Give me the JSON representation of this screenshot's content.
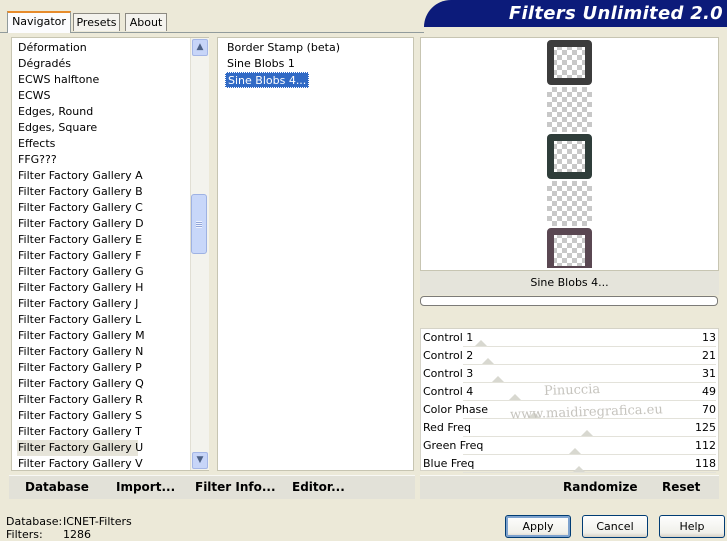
{
  "tabs": [
    {
      "label": "Navigator",
      "active": true
    },
    {
      "label": "Presets",
      "active": false
    },
    {
      "label": "About",
      "active": false
    }
  ],
  "banner": {
    "title": "Filters Unlimited 2.0"
  },
  "categories": [
    "Déformation",
    "Dégradés",
    "ECWS halftone",
    "ECWS",
    "Edges, Round",
    "Edges, Square",
    "Effects",
    "FFG???",
    "Filter Factory Gallery A",
    "Filter Factory Gallery B",
    "Filter Factory Gallery C",
    "Filter Factory Gallery D",
    "Filter Factory Gallery E",
    "Filter Factory Gallery F",
    "Filter Factory Gallery G",
    "Filter Factory Gallery H",
    "Filter Factory Gallery J",
    "Filter Factory Gallery L",
    "Filter Factory Gallery M",
    "Filter Factory Gallery N",
    "Filter Factory Gallery P",
    "Filter Factory Gallery Q",
    "Filter Factory Gallery R",
    "Filter Factory Gallery S",
    "Filter Factory Gallery T",
    "Filter Factory Gallery U",
    "Filter Factory Gallery V"
  ],
  "selected_category": "Filter Factory Gallery U",
  "filters": [
    "Border Stamp (beta)",
    "Sine Blobs 1",
    "Sine Blobs 4..."
  ],
  "selected_filter": "Sine Blobs 4...",
  "preview": {
    "filter_name": "Sine Blobs 4...",
    "progress": 0
  },
  "controls": [
    {
      "label": "Control 1",
      "value": "13",
      "level": 0.05
    },
    {
      "label": "Control 2",
      "value": "21",
      "level": 0.08
    },
    {
      "label": "Control 3",
      "value": "31",
      "level": 0.12
    },
    {
      "label": "Control 4",
      "value": "49",
      "level": 0.19
    },
    {
      "label": "Color Phase",
      "value": "70",
      "level": 0.27
    },
    {
      "label": "Red Freq",
      "value": "125",
      "level": 0.49
    },
    {
      "label": "Green Freq",
      "value": "112",
      "level": 0.44
    },
    {
      "label": "Blue Freq",
      "value": "118",
      "level": 0.46
    }
  ],
  "watermark": {
    "line1": "Pinuccia",
    "line2": "www.maidiregrafica.eu"
  },
  "toolbar": {
    "database": "Database",
    "import": "Import...",
    "filter_info": "Filter Info...",
    "editor": "Editor...",
    "randomize": "Randomize",
    "reset": "Reset"
  },
  "status": {
    "database_label": "Database:",
    "database_value": "ICNET-Filters",
    "filters_label": "Filters:",
    "filters_value": "1286"
  },
  "buttons": {
    "apply": "Apply",
    "cancel": "Cancel",
    "help": "Help"
  },
  "blob_colors": [
    "#3c3c3c",
    "#2f3d3a",
    "#5a4752"
  ]
}
